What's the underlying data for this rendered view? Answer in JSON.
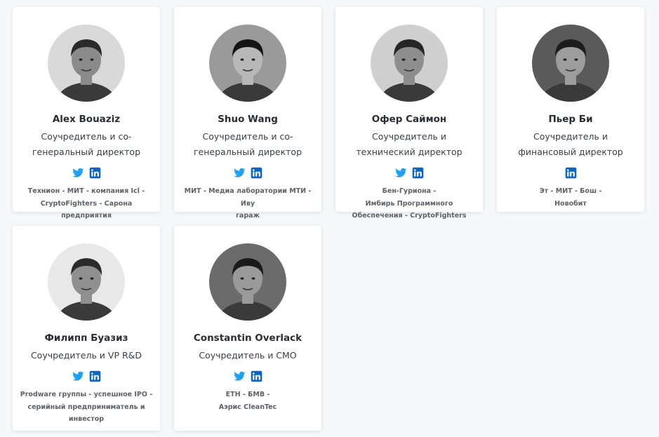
{
  "team": [
    {
      "name": "Alex Bouaziz",
      "role_lines": [
        "Соучредитель и со-",
        "генеральный директор"
      ],
      "socials": [
        "twitter-icon",
        "linkedin-icon"
      ],
      "bio_lines": [
        "Технион - МИТ - компания Icl -",
        "CryptoFighters - Сарона",
        "предприятия"
      ]
    },
    {
      "name": "Shuo Wang",
      "role_lines": [
        "Соучредитель и со-",
        "генеральный директор"
      ],
      "socials": [
        "twitter-icon",
        "linkedin-icon"
      ],
      "bio_lines": [
        "МИТ - Медиа лаборатории МТИ -",
        "Иву",
        "гараж"
      ]
    },
    {
      "name": "Офер Саймон",
      "role_lines": [
        "Соучредитель и",
        "технический директор"
      ],
      "socials": [
        "twitter-icon",
        "linkedin-icon"
      ],
      "bio_lines": [
        "Бен-Гуриона -",
        "Имбирь Программного",
        "Обеспечения - CryptoFighters"
      ]
    },
    {
      "name": "Пьер Би",
      "role_lines": [
        "Соучредитель и",
        "финансовый директор"
      ],
      "socials": [
        "linkedin-icon"
      ],
      "bio_lines": [
        "Эт - МИТ - Бош -",
        "Новобит"
      ]
    },
    {
      "name": "Филипп Буазиз",
      "role_lines": [
        "Соучредитель и VP R&D"
      ],
      "socials": [
        "twitter-icon",
        "linkedin-icon"
      ],
      "bio_lines": [
        "Prodware группы - успешное IPO -",
        "серийный предприниматель и",
        "инвестор"
      ]
    },
    {
      "name": "Constantin Overlack",
      "role_lines": [
        "Соучредитель и CMO"
      ],
      "socials": [
        "twitter-icon",
        "linkedin-icon"
      ],
      "bio_lines": [
        "ETH - БМВ -",
        "Аэрис CleanTec"
      ]
    }
  ],
  "colors": {
    "twitter": "#1da1f2",
    "linkedin": "#0a66c2",
    "background": "#f6f7fa",
    "card": "#ffffff"
  }
}
